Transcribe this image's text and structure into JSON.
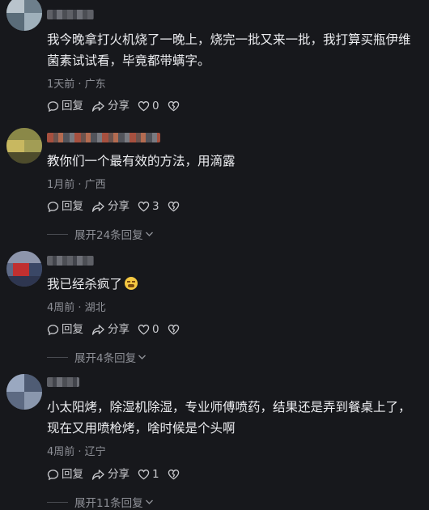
{
  "comments": [
    {
      "text": "我今晚拿打火机烧了一晚上，烧完一批又来一批，我打算买瓶伊维菌素试试看，毕竟都带螨字。",
      "meta": "1天前 · 广东",
      "reply_label": "回复",
      "share_label": "分享",
      "like_count": "0"
    },
    {
      "text": "教你们一个最有效的方法，用滴露",
      "meta": "1月前 · 广西",
      "reply_label": "回复",
      "share_label": "分享",
      "like_count": "3",
      "expand_label": "展开24条回复"
    },
    {
      "text": "我已经杀疯了",
      "emoji": "tired-face-emoji",
      "meta": "4周前 · 湖北",
      "reply_label": "回复",
      "share_label": "分享",
      "like_count": "0",
      "expand_label": "展开4条回复"
    },
    {
      "text": "小太阳烤，除湿机除湿，专业师傅喷药，结果还是弄到餐桌上了，现在又用喷枪烤，啥时候是个头啊",
      "meta": "4周前 · 辽宁",
      "reply_label": "回复",
      "share_label": "分享",
      "like_count": "1",
      "expand_label": "展开11条回复"
    }
  ],
  "icons": {
    "reply": "reply-bubble-icon",
    "share": "share-arrow-icon",
    "like": "heart-icon",
    "dislike": "broken-heart-icon",
    "expand": "chevron-down-icon"
  },
  "colors": {
    "background": "#17181c",
    "text": "#ecedf0",
    "meta": "#8e9097"
  }
}
